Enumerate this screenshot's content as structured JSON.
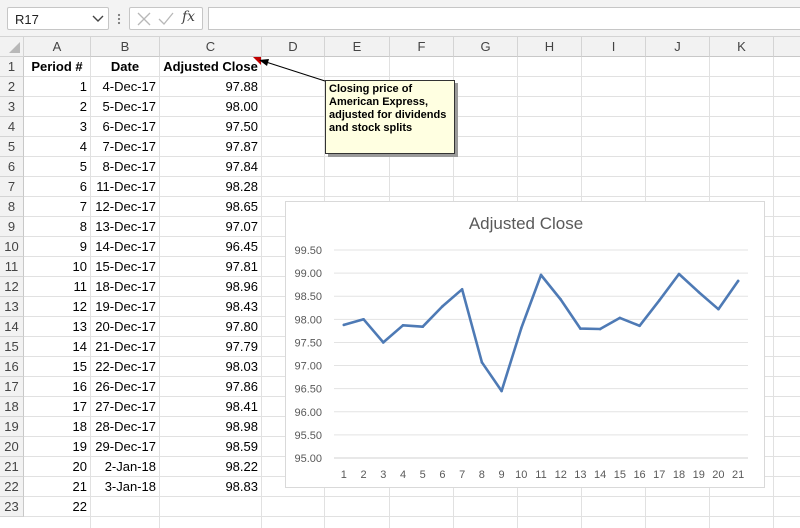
{
  "formula_bar": {
    "name_box": "R17",
    "fx_label": "fx",
    "formula": ""
  },
  "columns": [
    "A",
    "B",
    "C",
    "D",
    "E",
    "F",
    "G",
    "H",
    "I",
    "J",
    "K"
  ],
  "rows": [
    "1",
    "2",
    "3",
    "4",
    "5",
    "6",
    "7",
    "8",
    "9",
    "10",
    "11",
    "12",
    "13",
    "14",
    "15",
    "16",
    "17",
    "18",
    "19",
    "20",
    "21",
    "22",
    "23"
  ],
  "headers": {
    "period": "Period #",
    "date": "Date",
    "adjusted_close": "Adjusted Close"
  },
  "table": [
    {
      "period": "1",
      "date": "4-Dec-17",
      "close": "97.88"
    },
    {
      "period": "2",
      "date": "5-Dec-17",
      "close": "98.00"
    },
    {
      "period": "3",
      "date": "6-Dec-17",
      "close": "97.50"
    },
    {
      "period": "4",
      "date": "7-Dec-17",
      "close": "97.87"
    },
    {
      "period": "5",
      "date": "8-Dec-17",
      "close": "97.84"
    },
    {
      "period": "6",
      "date": "11-Dec-17",
      "close": "98.28"
    },
    {
      "period": "7",
      "date": "12-Dec-17",
      "close": "98.65"
    },
    {
      "period": "8",
      "date": "13-Dec-17",
      "close": "97.07"
    },
    {
      "period": "9",
      "date": "14-Dec-17",
      "close": "96.45"
    },
    {
      "period": "10",
      "date": "15-Dec-17",
      "close": "97.81"
    },
    {
      "period": "11",
      "date": "18-Dec-17",
      "close": "98.96"
    },
    {
      "period": "12",
      "date": "19-Dec-17",
      "close": "98.43"
    },
    {
      "period": "13",
      "date": "20-Dec-17",
      "close": "97.80"
    },
    {
      "period": "14",
      "date": "21-Dec-17",
      "close": "97.79"
    },
    {
      "period": "15",
      "date": "22-Dec-17",
      "close": "98.03"
    },
    {
      "period": "16",
      "date": "26-Dec-17",
      "close": "97.86"
    },
    {
      "period": "17",
      "date": "27-Dec-17",
      "close": "98.41"
    },
    {
      "period": "18",
      "date": "28-Dec-17",
      "close": "98.98"
    },
    {
      "period": "19",
      "date": "29-Dec-17",
      "close": "98.59"
    },
    {
      "period": "20",
      "date": "2-Jan-18",
      "close": "98.22"
    },
    {
      "period": "21",
      "date": "3-Jan-18",
      "close": "98.83"
    },
    {
      "period": "22",
      "date": "",
      "close": ""
    }
  ],
  "comment": {
    "text": "Closing price of American Express, adjusted for dividends and stock splits"
  },
  "colors": {
    "series_line": "#4e7ab5",
    "comment_bg": "#ffffe1",
    "comment_marker": "#c00000"
  },
  "chart_data": {
    "type": "line",
    "title": "Adjusted Close",
    "xlabel": "",
    "ylabel": "",
    "categories": [
      "1",
      "2",
      "3",
      "4",
      "5",
      "6",
      "7",
      "8",
      "9",
      "10",
      "11",
      "12",
      "13",
      "14",
      "15",
      "16",
      "17",
      "18",
      "19",
      "20",
      "21"
    ],
    "series": [
      {
        "values": [
          97.88,
          98.0,
          97.5,
          97.87,
          97.84,
          98.28,
          98.65,
          97.07,
          96.45,
          97.81,
          98.96,
          98.43,
          97.8,
          97.79,
          98.03,
          97.86,
          98.41,
          98.98,
          98.59,
          98.22,
          98.83
        ]
      }
    ],
    "ylim": [
      95.0,
      99.5
    ],
    "yticks": [
      "95.00",
      "95.50",
      "96.00",
      "96.50",
      "97.00",
      "97.50",
      "98.00",
      "98.50",
      "99.00",
      "99.50"
    ],
    "grid": true,
    "legend": "none"
  }
}
